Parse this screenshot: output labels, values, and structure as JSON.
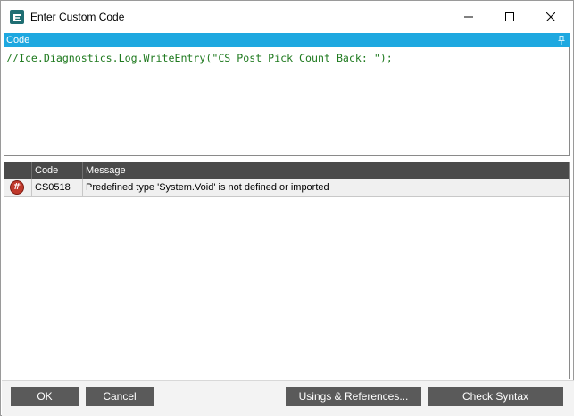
{
  "window": {
    "title": "Enter Custom Code",
    "app_icon": "epicor-e-icon",
    "controls": [
      "minimize-icon",
      "maximize-icon",
      "close-icon"
    ]
  },
  "code_panel": {
    "header": "Code",
    "pin_icon": "pin-icon",
    "code_text": "//Ice.Diagnostics.Log.WriteEntry(\"CS Post Pick Count Back: \");",
    "code_color": "#1f7a1f",
    "header_color": "#1ea8e0"
  },
  "errors_grid": {
    "columns": [
      "",
      "Code",
      "Message"
    ],
    "rows": [
      {
        "icon": "error-hash-icon",
        "code": "CS0518",
        "message": "Predefined type 'System.Void' is not defined or imported"
      }
    ]
  },
  "buttons": {
    "ok": "OK",
    "cancel": "Cancel",
    "usings": "Usings & References...",
    "check_syntax": "Check Syntax"
  }
}
